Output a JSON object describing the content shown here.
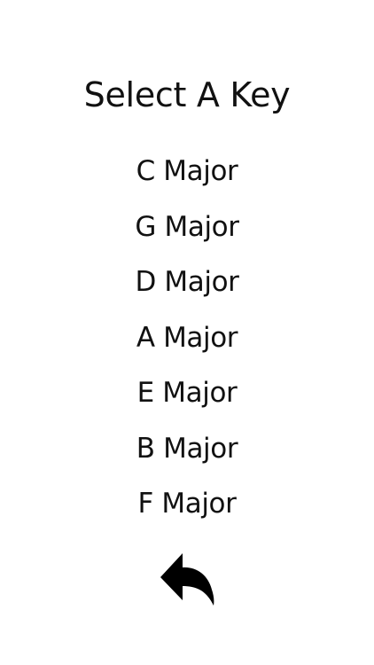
{
  "screen": {
    "title": "Select A Key",
    "keys": [
      {
        "label": "C Major"
      },
      {
        "label": "G Major"
      },
      {
        "label": "D Major"
      },
      {
        "label": "A Major"
      },
      {
        "label": "E Major"
      },
      {
        "label": "B Major"
      },
      {
        "label": "F Major"
      }
    ],
    "back_icon": "reply-arrow-icon"
  },
  "colors": {
    "background": "#ffffff",
    "text": "#111111",
    "icon": "#000000"
  }
}
